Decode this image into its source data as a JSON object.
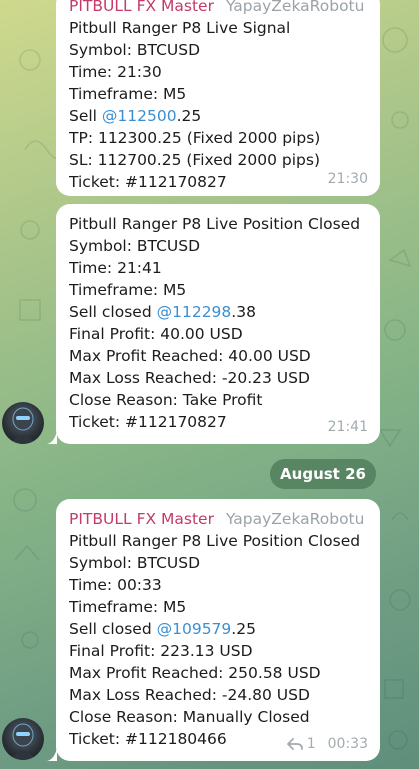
{
  "messages": [
    {
      "sender": "PITBULL FX Master",
      "via": "YapayZekaRobotu",
      "lines": {
        "l1": "Pitbull Ranger P8 Live Signal",
        "l2": "Symbol: BTCUSD",
        "l3": "Time: 21:30",
        "l4": "Timeframe: M5",
        "l5_pre": "Sell ",
        "l5_link": "@112500",
        "l5_post": ".25",
        "l6": "TP: 112300.25 (Fixed 2000 pips)",
        "l7": "SL: 112700.25 (Fixed 2000 pips)",
        "l8": "Ticket: #112170827"
      },
      "time": "21:30"
    },
    {
      "lines": {
        "l1": "Pitbull Ranger P8 Live Position Closed",
        "l2": "Symbol: BTCUSD",
        "l3": "Time: 21:41",
        "l4": "Timeframe: M5",
        "l5_pre": "Sell closed ",
        "l5_link": "@112298",
        "l5_post": ".38",
        "l6": "Final Profit: 40.00 USD",
        "l7": "Max Profit Reached: 40.00 USD",
        "l8": "Max Loss Reached: -20.23 USD",
        "l9": "Close Reason: Take Profit",
        "l10": "Ticket: #112170827"
      },
      "time": "21:41"
    },
    {
      "sender": "PITBULL FX Master",
      "via": "YapayZekaRobotu",
      "lines": {
        "l1": "Pitbull Ranger P8 Live Position Closed",
        "l2": "Symbol: BTCUSD",
        "l3": "Time: 00:33",
        "l4": "Timeframe: M5",
        "l5_pre": "Sell closed ",
        "l5_link": "@109579",
        "l5_post": ".25",
        "l6": "Final Profit: 223.13 USD",
        "l7": "Max Profit Reached: 250.58 USD",
        "l8": "Max Loss Reached: -24.80 USD",
        "l9": "Close Reason: Manually Closed",
        "l10": "Ticket: #112180466"
      },
      "replies": "1",
      "time": "00:33"
    }
  ],
  "date_separator": "August 26",
  "icons": {
    "reply": "reply-arrow-icon",
    "avatar": "robot-avatar"
  },
  "colors": {
    "sender": "#c33a6b",
    "link": "#3a8fd3",
    "meta": "#a3abb0"
  }
}
